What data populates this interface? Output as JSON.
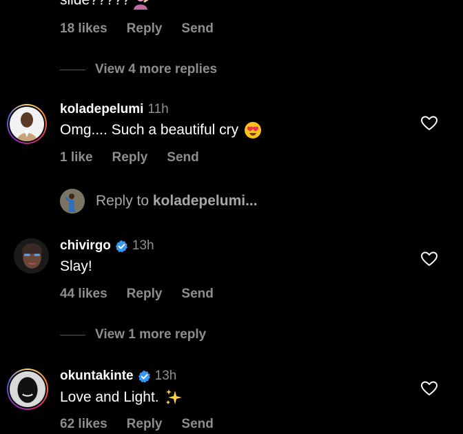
{
  "top_comment": {
    "text_partial": "slide?????",
    "likes": "18 likes",
    "reply": "Reply",
    "send": "Send"
  },
  "view_more_1": {
    "label": "View 4 more replies"
  },
  "comments": [
    {
      "username": "koladepelumi",
      "time": "11h",
      "text": "Omg.... Such a beautiful cry",
      "likes": "1 like",
      "reply": "Reply",
      "send": "Send",
      "verified": false
    },
    {
      "username": "chivirgo",
      "time": "13h",
      "text": "Slay!",
      "likes": "44 likes",
      "reply": "Reply",
      "send": "Send",
      "verified": true
    },
    {
      "username": "okuntakinte",
      "time": "13h",
      "text": "Love and Light.",
      "likes": "62 likes",
      "reply": "Reply",
      "send": "Send",
      "verified": true
    }
  ],
  "reply_prompt": {
    "prefix": "Reply to ",
    "target": "koladepelumi..."
  },
  "view_more_2": {
    "label": "View 1 more reply"
  },
  "colors": {
    "background": "#000000",
    "secondary_text": "#8e8e8e",
    "verified": "#3897f0"
  },
  "icons": {
    "heart": "heart-outline-icon",
    "verified": "verified-badge-icon",
    "heart_eyes": "heart-eyes-emoji",
    "sparkles": "sparkles-emoji",
    "person_tipping_hand": "person-tipping-hand-emoji"
  }
}
